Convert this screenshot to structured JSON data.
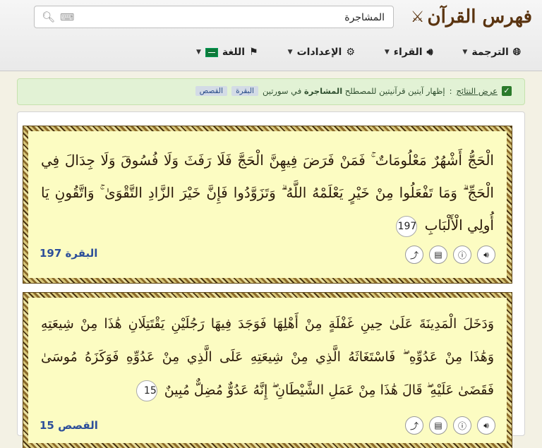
{
  "header": {
    "logo_text": "فهرس القرآن",
    "logo_icon": "crossed-swords-icon",
    "search": {
      "value": "المشاجرة",
      "placeholder": ""
    }
  },
  "nav": {
    "translation": "الترجمة",
    "reciters": "القراء",
    "settings": "الإعدادات",
    "language": "اللغة"
  },
  "notice": {
    "prefix": "عرض النتائج",
    "sep": " : ",
    "text_a": "إظهار آيتين قرآنيتين للمصطلح ",
    "term": "المشاجرة",
    "text_b": " في سورتين",
    "tags": [
      "البقرة",
      "القصص"
    ]
  },
  "results": [
    {
      "text": "الْحَجُّ أَشْهُرٌ مَعْلُومَاتٌ ۚ فَمَنْ فَرَضَ فِيهِنَّ الْحَجَّ فَلَا رَفَثَ وَلَا فُسُوقَ وَلَا جِدَالَ فِي الْحَجِّ ۗ وَمَا تَفْعَلُوا مِنْ خَيْرٍ يَعْلَمْهُ اللَّهُ ۗ وَتَزَوَّدُوا فَإِنَّ خَيْرَ الزَّادِ التَّقْوَىٰ ۚ وَاتَّقُونِ يَا أُولِي الْأَلْبَابِ",
      "ayah": "197",
      "surah_ref": "البقرة 197"
    },
    {
      "text": "وَدَخَلَ الْمَدِينَةَ عَلَىٰ حِينِ غَفْلَةٍ مِنْ أَهْلِهَا فَوَجَدَ فِيهَا رَجُلَيْنِ يَقْتَتِلَانِ هَٰذَا مِنْ شِيعَتِهِ وَهَٰذَا مِنْ عَدُوِّهِ ۖ فَاسْتَغَاثَهُ الَّذِي مِنْ شِيعَتِهِ عَلَى الَّذِي مِنْ عَدُوِّهِ فَوَكَزَهُ مُوسَىٰ فَقَضَىٰ عَلَيْهِ ۖ قَالَ هَٰذَا مِنْ عَمَلِ الشَّيْطَانِ ۖ إِنَّهُ عَدُوٌّ مُضِلٌّ مُبِينٌ",
      "ayah": "15",
      "surah_ref": "القصص 15"
    }
  ]
}
